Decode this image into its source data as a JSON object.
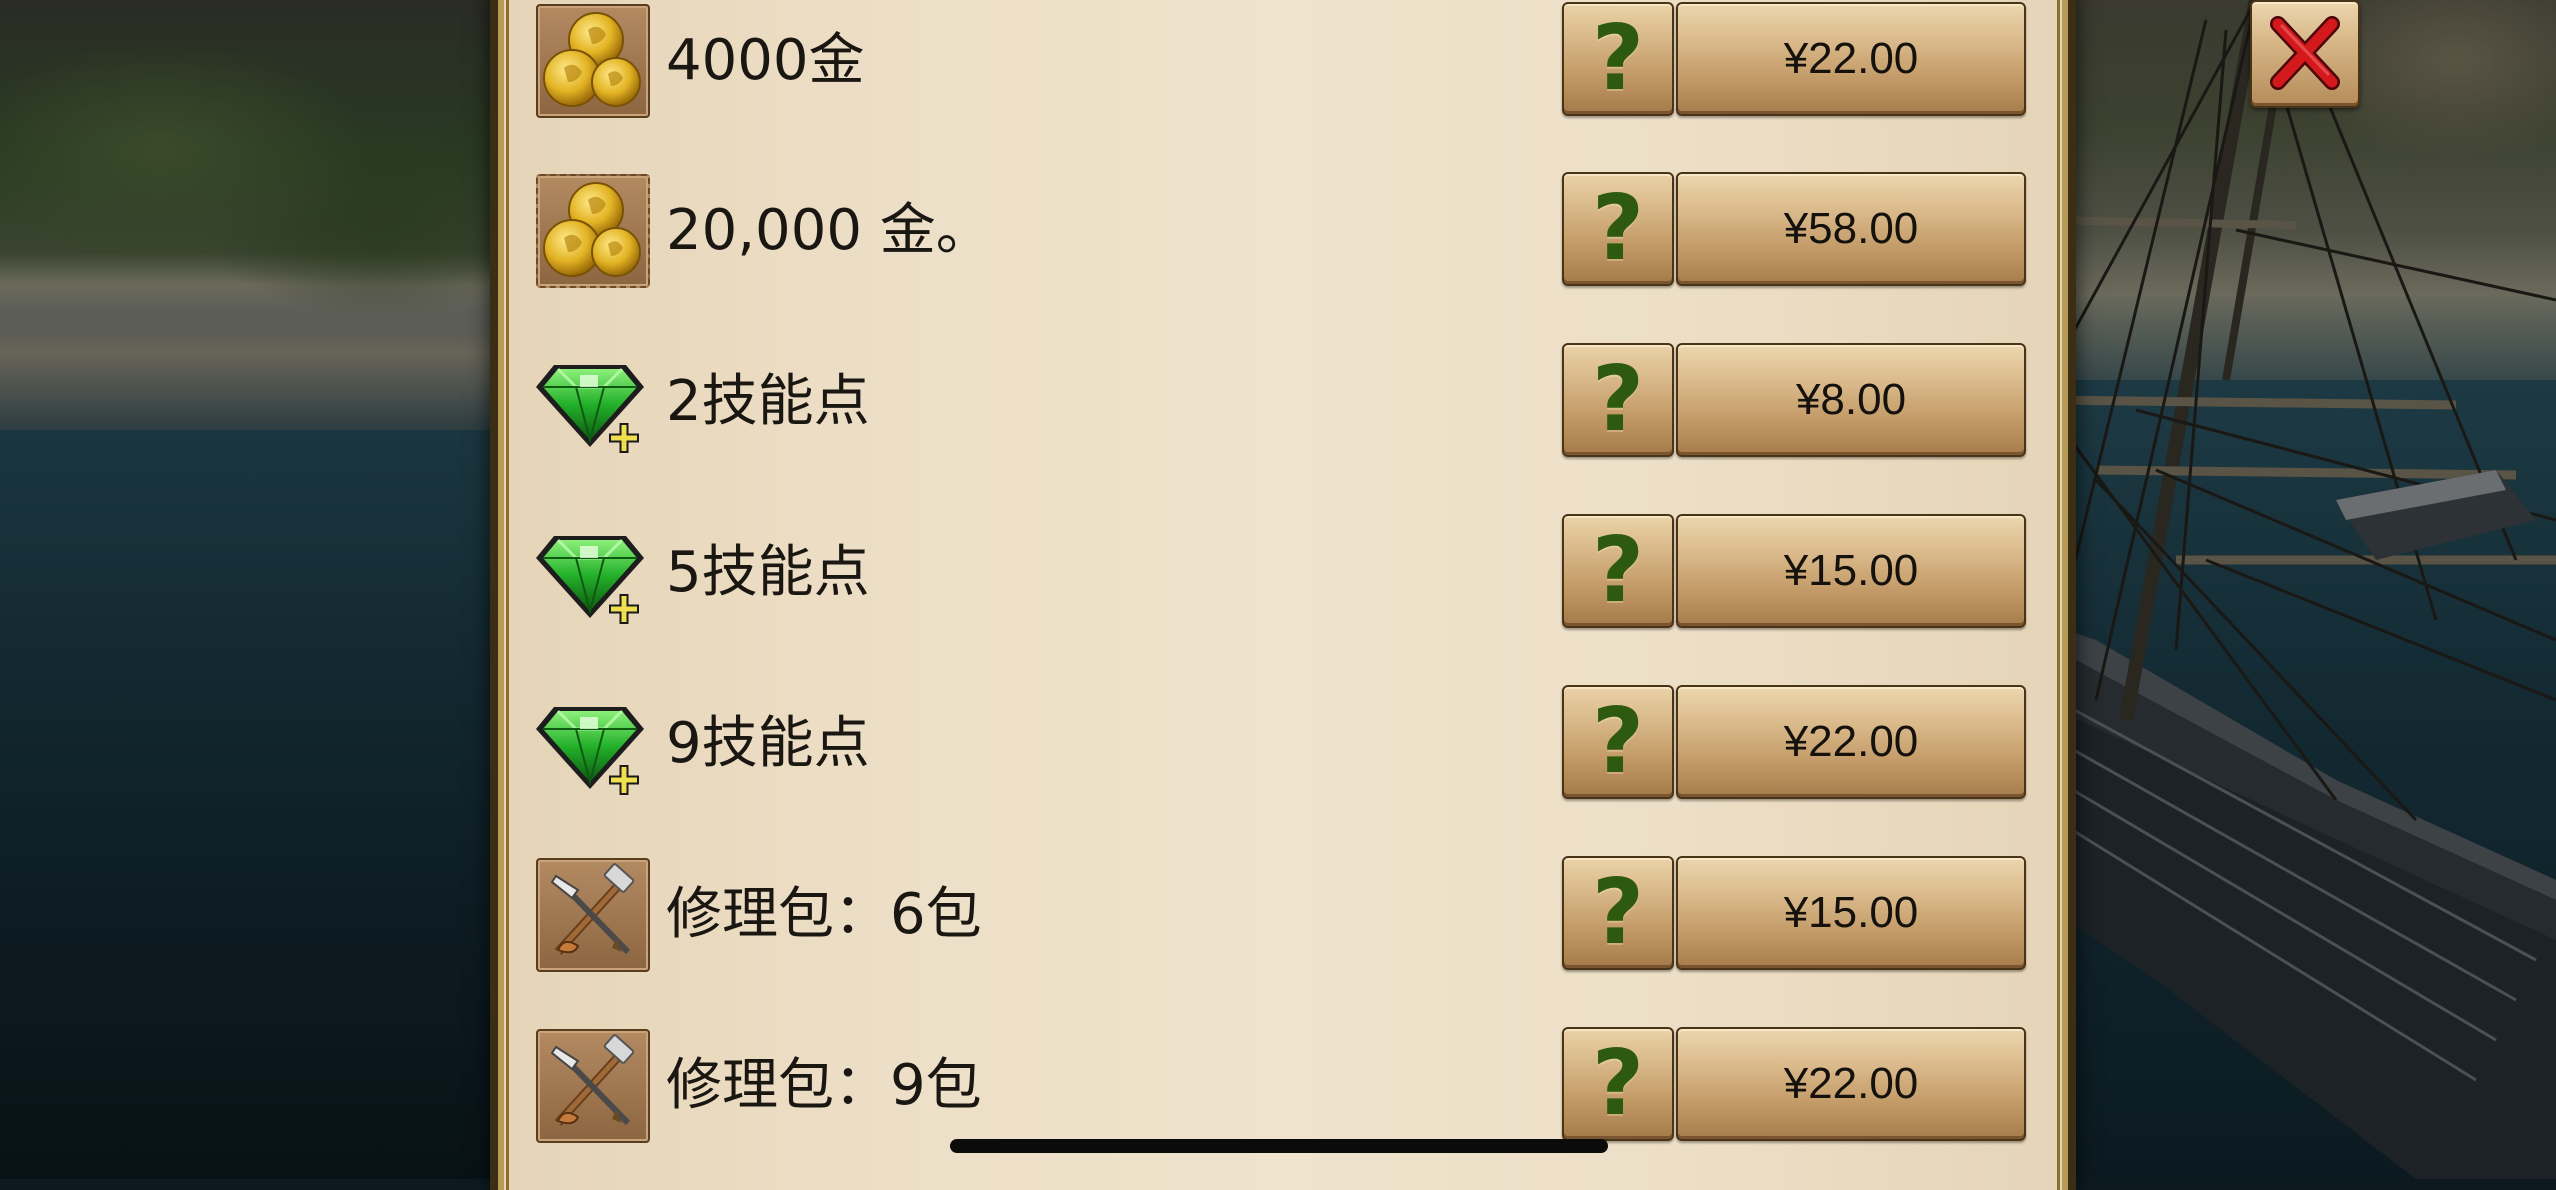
{
  "shop": {
    "items": [
      {
        "icon": "gold-coins-icon",
        "label": "4000金",
        "help": "?",
        "price": "¥22.00"
      },
      {
        "icon": "gold-coins-icon",
        "label": "20,000 金。",
        "help": "?",
        "price": "¥58.00"
      },
      {
        "icon": "emerald-plus-icon",
        "label": "2技能点",
        "help": "?",
        "price": "¥8.00"
      },
      {
        "icon": "emerald-plus-icon",
        "label": "5技能点",
        "help": "?",
        "price": "¥15.00"
      },
      {
        "icon": "emerald-plus-icon",
        "label": "9技能点",
        "help": "?",
        "price": "¥22.00"
      },
      {
        "icon": "repair-tools-icon",
        "label": "修理包：6包",
        "help": "?",
        "price": "¥15.00"
      },
      {
        "icon": "repair-tools-icon",
        "label": "修理包：9包",
        "help": "?",
        "price": "¥22.00"
      }
    ]
  },
  "close": {
    "icon": "close-x-icon"
  },
  "colors": {
    "panel": "#efe3cd",
    "button": "#c59d6a",
    "question_mark": "#2e5a10",
    "close_x": "#c0191c"
  }
}
